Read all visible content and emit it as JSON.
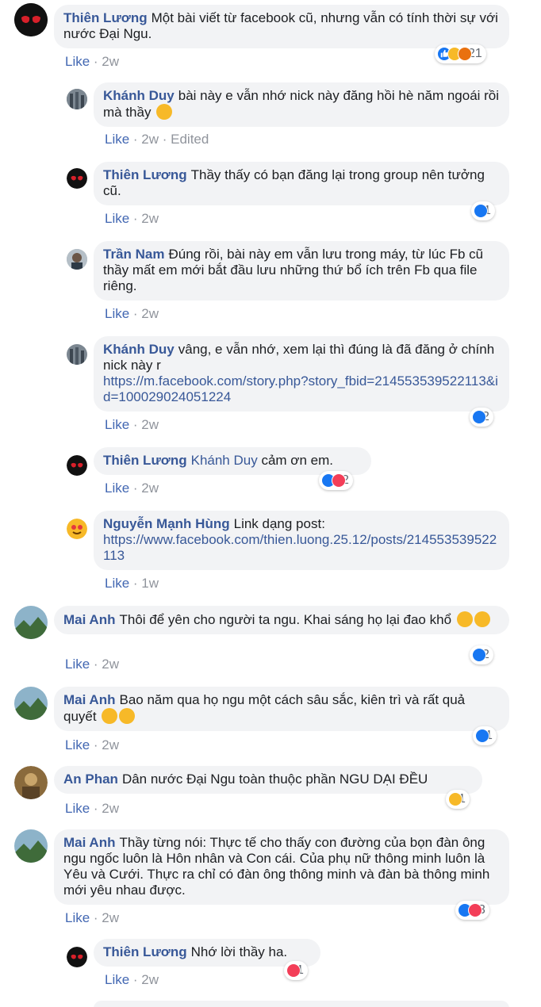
{
  "comments": [
    {
      "name": "Thiên Lương",
      "text": "Một bài viết từ facebook cũ, nhưng vẫn có tính thời sự với nước Đại Ngu.",
      "like": "Like",
      "time": "2w",
      "react_count": "21"
    },
    {
      "name": "Khánh Duy",
      "text": "bài này e vẫn nhớ nick này đăng hồi hè năm ngoái rồi mà thầy",
      "like": "Like",
      "time": "2w",
      "edited": "Edited"
    },
    {
      "name": "Thiên Lương",
      "text": "Thầy thấy có bạn đăng lại trong group nên tưởng cũ.",
      "like": "Like",
      "time": "2w",
      "react_count": "1"
    },
    {
      "name": "Trần Nam",
      "text": "Đúng rồi, bài này em vẫn lưu trong máy, từ lúc Fb cũ thầy mất em mới bắt đầu lưu những thứ bổ ích trên Fb qua file riêng.",
      "like": "Like",
      "time": "2w"
    },
    {
      "name": "Khánh Duy",
      "text": "vâng, e vẫn nhớ, xem lại thì đúng là đã đăng ở chính nick này r",
      "link": "https://m.facebook.com/story.php?story_fbid=214553539522113&id=100029024051224",
      "like": "Like",
      "time": "2w",
      "react_count": "2"
    },
    {
      "name": "Thiên Lương",
      "mention": "Khánh Duy",
      "text": "cảm ơn em.",
      "like": "Like",
      "time": "2w",
      "react_count": "2"
    },
    {
      "name": "Nguyễn Mạnh Hùng",
      "text": "Link dạng post:",
      "link": "https://www.facebook.com/thien.luong.25.12/posts/214553539522113",
      "like": "Like",
      "time": "1w"
    },
    {
      "name": "Mai Anh",
      "text": "Thôi để yên cho người ta ngu. Khai sáng họ lại đao khổ",
      "like": "Like",
      "time": "2w",
      "react_count": "2"
    },
    {
      "name": "Mai Anh",
      "text": "Bao năm qua họ ngu một cách sâu sắc, kiên trì và rất quả quyết",
      "like": "Like",
      "time": "2w",
      "react_count": "1"
    },
    {
      "name": "An Phan",
      "text": "Dân nước Đại Ngu toàn thuộc phần NGU DẠI ĐỀU",
      "like": "Like",
      "time": "2w",
      "react_count": "1"
    },
    {
      "name": "Mai Anh",
      "text": "Thầy từng nói: Thực tế cho thấy con đường của bọn đàn ông ngu ngốc luôn là Hôn nhân và Con cái. Của phụ nữ thông minh luôn là Yêu và Cưới. Thực ra chỉ có đàn ông thông minh và đàn bà thông minh mới yêu nhau được.",
      "like": "Like",
      "time": "2w",
      "react_count": "3"
    },
    {
      "name": "Thiên Lương",
      "text": "Nhớ lời thầy ha.",
      "like": "Like",
      "time": "2w",
      "react_count": "1"
    }
  ],
  "colors": {
    "link": "#385898",
    "bubble": "#f2f3f5",
    "meta": "#90949c",
    "like_blue": "#1877f2",
    "love_red": "#f33e58",
    "haha_yellow": "#f7b928"
  }
}
